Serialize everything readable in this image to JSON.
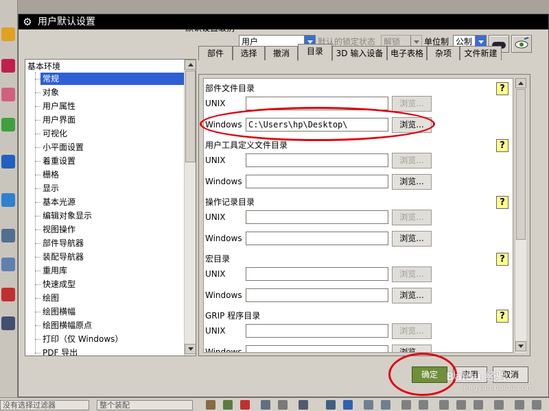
{
  "window": {
    "title": "用户默认设置"
  },
  "topbar": {
    "level_label": "默认设置级别",
    "level_value": "用户",
    "lock_label": "默认的锁定状态",
    "lock_value": "解锁",
    "unit_label": "单位制",
    "unit_value": "公制"
  },
  "tree": {
    "root": "基本环境",
    "items": [
      {
        "label": "常规"
      },
      {
        "label": "对象"
      },
      {
        "label": "用户属性"
      },
      {
        "label": "用户界面"
      },
      {
        "label": "可视化"
      },
      {
        "label": "小平面设置"
      },
      {
        "label": "着重设置"
      },
      {
        "label": "栅格"
      },
      {
        "label": "显示"
      },
      {
        "label": "基本光源"
      },
      {
        "label": "编辑对象显示"
      },
      {
        "label": "视图操作"
      },
      {
        "label": "部件导航器"
      },
      {
        "label": "装配导航器"
      },
      {
        "label": "重用库"
      },
      {
        "label": "快速成型"
      },
      {
        "label": "绘图"
      },
      {
        "label": "绘图横幅"
      },
      {
        "label": "绘图横幅原点"
      },
      {
        "label": "打印（仅 Windows）"
      },
      {
        "label": "PDF 导出"
      }
    ]
  },
  "tabs": [
    {
      "label": "部件"
    },
    {
      "label": "选择"
    },
    {
      "label": "撤消"
    },
    {
      "label": "目录"
    },
    {
      "label": "3D 输入设备"
    },
    {
      "label": "电子表格"
    },
    {
      "label": "杂项"
    },
    {
      "label": "文件新建"
    }
  ],
  "sections": [
    {
      "title": "部件文件目录",
      "unix_label": "UNIX",
      "unix_value": "",
      "windows_label": "Windows",
      "windows_value": "C:\\Users\\hp\\Desktop\\",
      "browse": "浏览..."
    },
    {
      "title": "用户工具定义文件目录",
      "unix_label": "UNIX",
      "unix_value": "",
      "windows_label": "Windows",
      "windows_value": "",
      "browse": "浏览..."
    },
    {
      "title": "操作记录目录",
      "unix_label": "UNIX",
      "unix_value": "",
      "windows_label": "Windows",
      "windows_value": "",
      "browse": "浏览..."
    },
    {
      "title": "宏目录",
      "unix_label": "UNIX",
      "unix_value": "",
      "windows_label": "Windows",
      "windows_value": "",
      "browse": "浏览..."
    },
    {
      "title": "GRIP 程序目录",
      "unix_label": "UNIX",
      "unix_value": "",
      "windows_label": "Windows",
      "windows_value": "",
      "browse": "浏览..."
    }
  ],
  "buttons": {
    "ok": "确定",
    "apply": "应用",
    "cancel": "取消"
  },
  "statusbar": {
    "filter_placeholder": "没有选择过滤器",
    "assembly": "整个装配"
  },
  "watermark": {
    "brand": "Baidu 经验",
    "url": "jingyan.baidu.com"
  },
  "colors": {
    "titlebar": "#000000",
    "selection": "#2f5fd4",
    "highlight_ring": "#e10010",
    "primary_button": "#6f8f3a"
  }
}
